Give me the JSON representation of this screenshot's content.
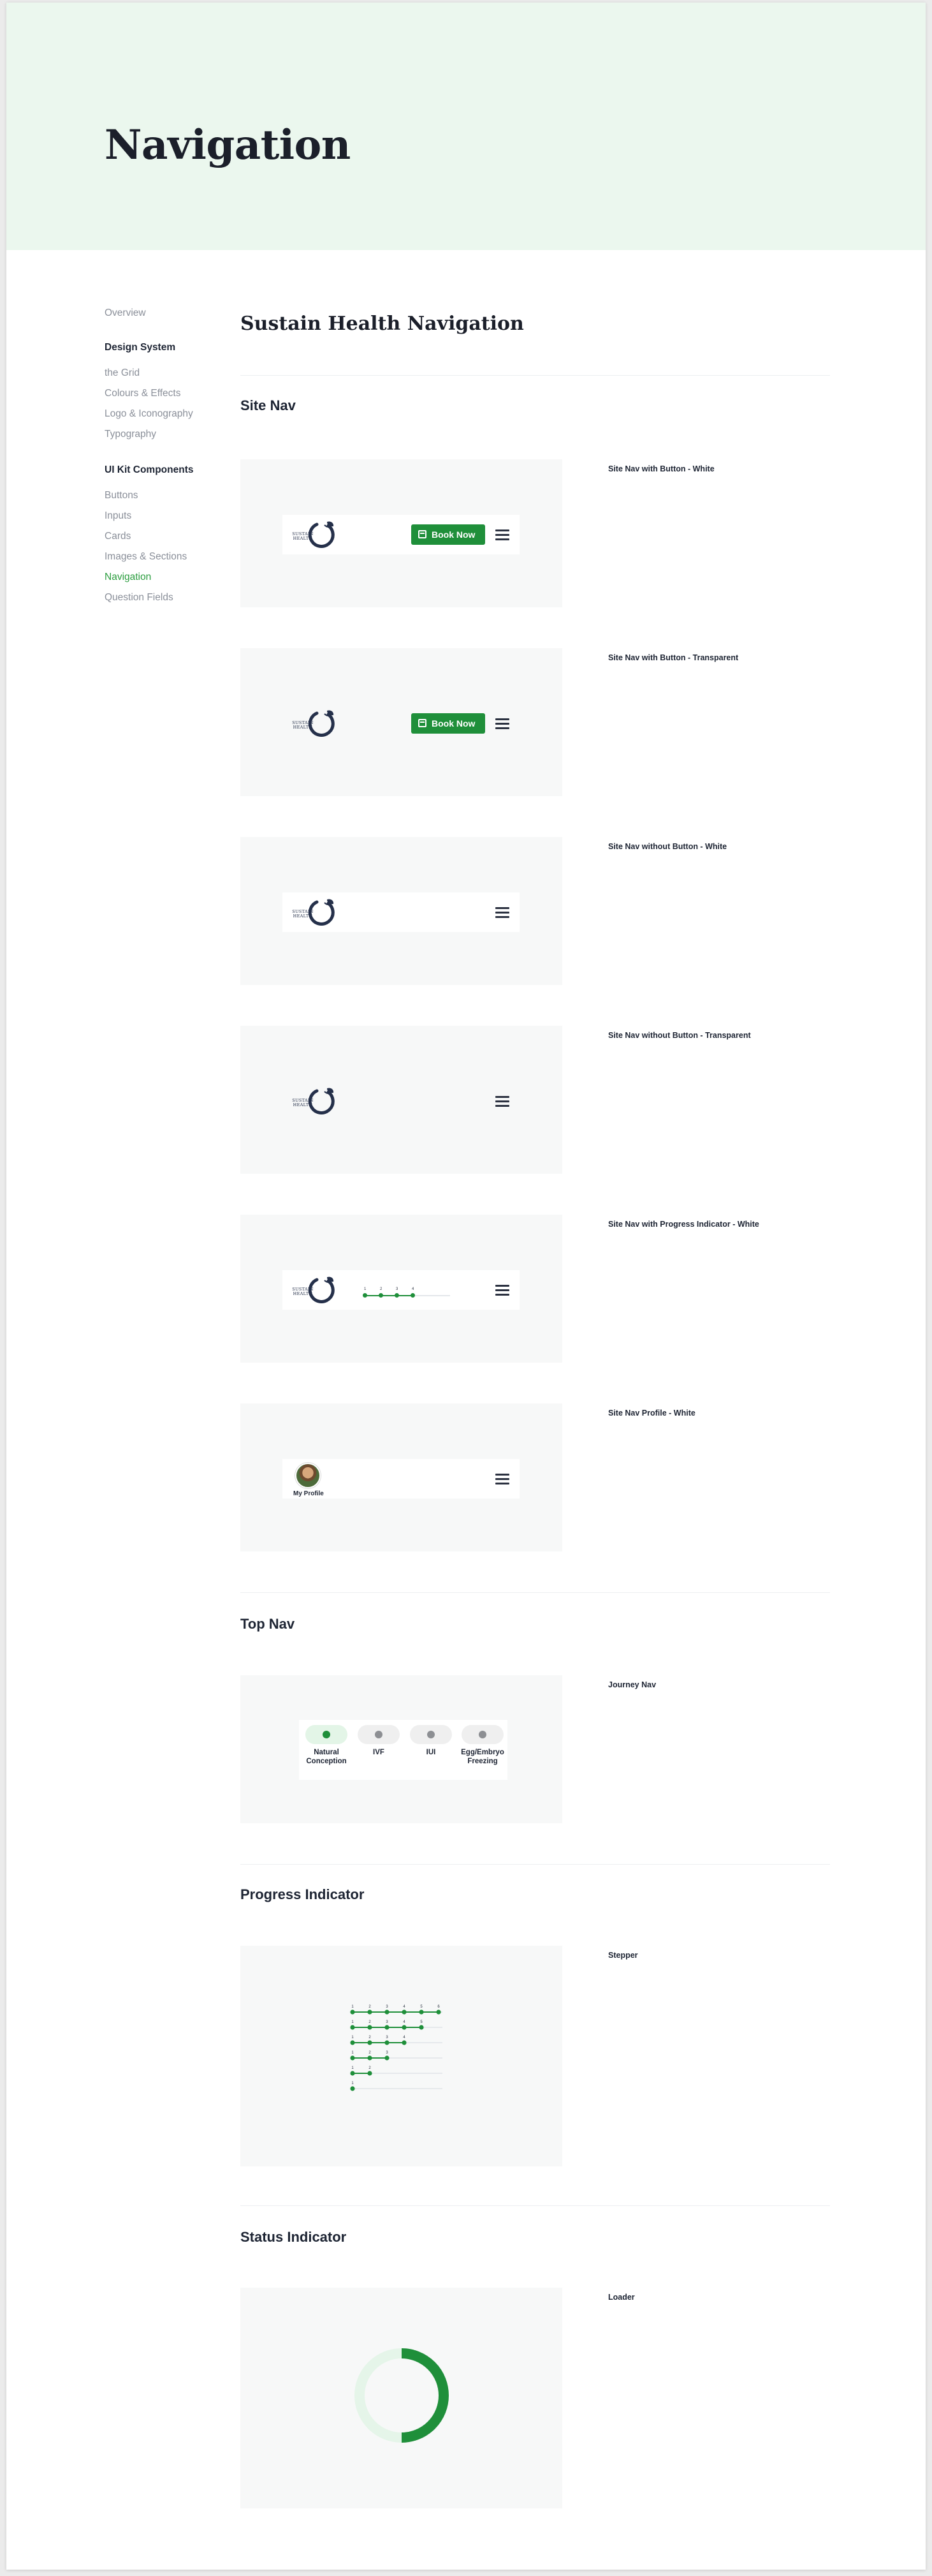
{
  "hero": {
    "title": "Navigation"
  },
  "sidebar": {
    "overview": "Overview",
    "design_system": {
      "heading": "Design System",
      "items": [
        "the Grid",
        "Colours & Effects",
        "Logo & Iconography",
        "Typography"
      ]
    },
    "ui_kit": {
      "heading": "UI Kit Components",
      "items": [
        "Buttons",
        "Inputs",
        "Cards",
        "Images & Sections",
        "Navigation",
        "Question Fields"
      ],
      "active": "Navigation"
    }
  },
  "main": {
    "title": "Sustain Health Navigation",
    "sections": {
      "site_nav": {
        "title": "Site Nav",
        "variants": [
          "Site Nav with Button  - White",
          "Site Nav with Button - Transparent",
          "Site Nav without Button  - White",
          "Site Nav without Button  - Transparent",
          "Site Nav with Progress Indicator  - White",
          "Site Nav Profile - White"
        ]
      },
      "top_nav": {
        "title": "Top Nav",
        "label": "Journey Nav"
      },
      "progress": {
        "title": "Progress Indicator",
        "label": "Stepper"
      },
      "status": {
        "title": "Status Indicator",
        "label": "Loader"
      }
    }
  },
  "components": {
    "logo_text": "SUSTAIN HEALTH",
    "book_button": "Book Now",
    "profile_label": "My Profile",
    "mini_progress": {
      "steps": [
        "1",
        "2",
        "3",
        "4"
      ]
    },
    "journey_items": [
      {
        "label": "Natural Conception",
        "active": true
      },
      {
        "label": "IVF",
        "active": false
      },
      {
        "label": "IUI",
        "active": false
      },
      {
        "label": "Egg/Embryo Freezing",
        "active": false
      }
    ],
    "stepper": {
      "numbers": [
        "1",
        "2",
        "3",
        "4",
        "5",
        "6"
      ],
      "rows_completed": [
        6,
        5,
        4,
        3,
        2,
        1
      ]
    },
    "loader": {
      "progress": 0.5
    }
  },
  "colors": {
    "brand_green": "#1f8f3a",
    "nav_active_green": "#2a9d3e",
    "hero_bg": "#ebf7ee",
    "panel_bg": "#f7f8f8",
    "navy": "#25304a"
  },
  "icons": {
    "logo": "sustain-health-logo",
    "calendar": "calendar-icon",
    "menu": "hamburger-menu-icon"
  }
}
